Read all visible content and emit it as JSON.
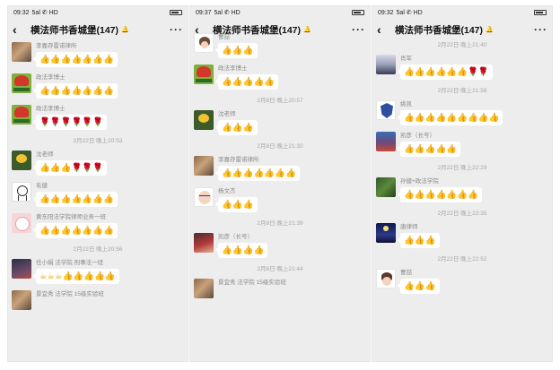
{
  "panels": [
    {
      "status": {
        "time": "09:32",
        "signal": "5al ✆ HD"
      },
      "title": "横法师书香城堡(147)",
      "items": [
        {
          "kind": "msg",
          "avatar": "av-photo",
          "sender": "李嘉存雷诺律所",
          "content": "👍👍👍👍👍👍👍"
        },
        {
          "kind": "msg",
          "avatar": "av-law",
          "sender": "政法李博士",
          "content": "👍👍👍👍👍👍👍"
        },
        {
          "kind": "msg",
          "avatar": "av-law",
          "sender": "政法李博士",
          "content": "🌹🌹🌹🌹🌹🌹"
        },
        {
          "kind": "ts",
          "text": "2月22日 晚上20:53"
        },
        {
          "kind": "msg",
          "avatar": "av-flower",
          "sender": "沈老师",
          "content": "👍👍👍🌹🌹🌹"
        },
        {
          "kind": "msg",
          "avatar": "av-line",
          "sender": "毛健",
          "content": "👍👍👍👍👍👍👍"
        },
        {
          "kind": "msg",
          "avatar": "av-pink",
          "sender": "黄东阳法学院律师业务一班",
          "content": "👍👍👍👍👍👍👍"
        },
        {
          "kind": "ts",
          "text": "2月22日 晚上20:56"
        },
        {
          "kind": "msg",
          "avatar": "av-dark",
          "sender": "任小娟 法学院 刑事法一班",
          "content": "☕☕☕👍👍👍👍👍"
        },
        {
          "kind": "msg",
          "avatar": "av-photo",
          "sender": "景宜秀 法学院 15级实验班",
          "content": ""
        }
      ]
    },
    {
      "status": {
        "time": "09:37",
        "signal": "5al ✆ HD"
      },
      "title": "横法师书香城堡(147)",
      "items": [
        {
          "kind": "msg",
          "avatar": "av-girl",
          "sender": "曹喆",
          "content": "👍👍👍"
        },
        {
          "kind": "msg",
          "avatar": "av-law",
          "sender": "政法李博士",
          "content": "👍👍👍👍👍"
        },
        {
          "kind": "ts",
          "text": "2月8日 晚上20:57"
        },
        {
          "kind": "msg",
          "avatar": "av-flower",
          "sender": "沈老师",
          "content": "👍👍👍"
        },
        {
          "kind": "ts",
          "text": "2月8日 晚上21:30"
        },
        {
          "kind": "msg",
          "avatar": "av-photo",
          "sender": "李嘉存雷诺律所",
          "content": "👍👍👍👍👍👍👍"
        },
        {
          "kind": "msg",
          "avatar": "av-glasses",
          "sender": "杨文杰",
          "content": "👍👍👍"
        },
        {
          "kind": "ts",
          "text": "2月8日 晚上21:39"
        },
        {
          "kind": "msg",
          "avatar": "av-red",
          "sender": "凯彦（长号）",
          "content": "👍👍👍👍"
        },
        {
          "kind": "ts",
          "text": "2月8日 晚上21:44"
        },
        {
          "kind": "msg",
          "avatar": "av-photo",
          "sender": "景宜秀 法学院 15级实验班",
          "content": ""
        }
      ]
    },
    {
      "status": {
        "time": "09:32",
        "signal": "5al ✆ HD"
      },
      "title": "横法师书香城堡(147)",
      "items": [
        {
          "kind": "ts",
          "text": "2月22日 晚上21:40"
        },
        {
          "kind": "msg",
          "avatar": "av-portrait",
          "sender": "肖军",
          "content": "👍👍👍👍👍👍🌹🌹"
        },
        {
          "kind": "ts",
          "text": "2月22日 晚上21:58"
        },
        {
          "kind": "msg",
          "avatar": "av-badge",
          "sender": "姚凯",
          "content": "👍👍👍👍👍👍👍👍👍"
        },
        {
          "kind": "msg",
          "avatar": "av-city",
          "sender": "凯彦（长号）",
          "content": "👍👍👍👍👍"
        },
        {
          "kind": "ts",
          "text": "2月22日 晚上22:29"
        },
        {
          "kind": "msg",
          "avatar": "av-plant",
          "sender": "孙健+政法学院",
          "content": "👍👍👍👍👍👍👍"
        },
        {
          "kind": "ts",
          "text": "2月22日 晚上22:35"
        },
        {
          "kind": "msg",
          "avatar": "av-night",
          "sender": "唐律师",
          "content": "👍👍👍"
        },
        {
          "kind": "ts",
          "text": "2月22日 晚上22:52"
        },
        {
          "kind": "msg",
          "avatar": "av-child",
          "sender": "曹喆",
          "content": "👍👍👍"
        }
      ]
    }
  ]
}
